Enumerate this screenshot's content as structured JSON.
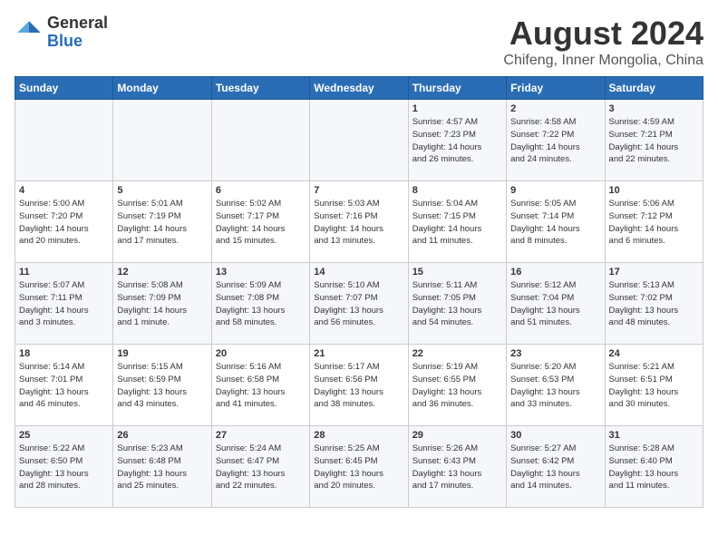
{
  "logo": {
    "general": "General",
    "blue": "Blue"
  },
  "title": "August 2024",
  "subtitle": "Chifeng, Inner Mongolia, China",
  "days_of_week": [
    "Sunday",
    "Monday",
    "Tuesday",
    "Wednesday",
    "Thursday",
    "Friday",
    "Saturday"
  ],
  "weeks": [
    [
      {
        "day": "",
        "info": ""
      },
      {
        "day": "",
        "info": ""
      },
      {
        "day": "",
        "info": ""
      },
      {
        "day": "",
        "info": ""
      },
      {
        "day": "1",
        "info": "Sunrise: 4:57 AM\nSunset: 7:23 PM\nDaylight: 14 hours\nand 26 minutes."
      },
      {
        "day": "2",
        "info": "Sunrise: 4:58 AM\nSunset: 7:22 PM\nDaylight: 14 hours\nand 24 minutes."
      },
      {
        "day": "3",
        "info": "Sunrise: 4:59 AM\nSunset: 7:21 PM\nDaylight: 14 hours\nand 22 minutes."
      }
    ],
    [
      {
        "day": "4",
        "info": "Sunrise: 5:00 AM\nSunset: 7:20 PM\nDaylight: 14 hours\nand 20 minutes."
      },
      {
        "day": "5",
        "info": "Sunrise: 5:01 AM\nSunset: 7:19 PM\nDaylight: 14 hours\nand 17 minutes."
      },
      {
        "day": "6",
        "info": "Sunrise: 5:02 AM\nSunset: 7:17 PM\nDaylight: 14 hours\nand 15 minutes."
      },
      {
        "day": "7",
        "info": "Sunrise: 5:03 AM\nSunset: 7:16 PM\nDaylight: 14 hours\nand 13 minutes."
      },
      {
        "day": "8",
        "info": "Sunrise: 5:04 AM\nSunset: 7:15 PM\nDaylight: 14 hours\nand 11 minutes."
      },
      {
        "day": "9",
        "info": "Sunrise: 5:05 AM\nSunset: 7:14 PM\nDaylight: 14 hours\nand 8 minutes."
      },
      {
        "day": "10",
        "info": "Sunrise: 5:06 AM\nSunset: 7:12 PM\nDaylight: 14 hours\nand 6 minutes."
      }
    ],
    [
      {
        "day": "11",
        "info": "Sunrise: 5:07 AM\nSunset: 7:11 PM\nDaylight: 14 hours\nand 3 minutes."
      },
      {
        "day": "12",
        "info": "Sunrise: 5:08 AM\nSunset: 7:09 PM\nDaylight: 14 hours\nand 1 minute."
      },
      {
        "day": "13",
        "info": "Sunrise: 5:09 AM\nSunset: 7:08 PM\nDaylight: 13 hours\nand 58 minutes."
      },
      {
        "day": "14",
        "info": "Sunrise: 5:10 AM\nSunset: 7:07 PM\nDaylight: 13 hours\nand 56 minutes."
      },
      {
        "day": "15",
        "info": "Sunrise: 5:11 AM\nSunset: 7:05 PM\nDaylight: 13 hours\nand 54 minutes."
      },
      {
        "day": "16",
        "info": "Sunrise: 5:12 AM\nSunset: 7:04 PM\nDaylight: 13 hours\nand 51 minutes."
      },
      {
        "day": "17",
        "info": "Sunrise: 5:13 AM\nSunset: 7:02 PM\nDaylight: 13 hours\nand 48 minutes."
      }
    ],
    [
      {
        "day": "18",
        "info": "Sunrise: 5:14 AM\nSunset: 7:01 PM\nDaylight: 13 hours\nand 46 minutes."
      },
      {
        "day": "19",
        "info": "Sunrise: 5:15 AM\nSunset: 6:59 PM\nDaylight: 13 hours\nand 43 minutes."
      },
      {
        "day": "20",
        "info": "Sunrise: 5:16 AM\nSunset: 6:58 PM\nDaylight: 13 hours\nand 41 minutes."
      },
      {
        "day": "21",
        "info": "Sunrise: 5:17 AM\nSunset: 6:56 PM\nDaylight: 13 hours\nand 38 minutes."
      },
      {
        "day": "22",
        "info": "Sunrise: 5:19 AM\nSunset: 6:55 PM\nDaylight: 13 hours\nand 36 minutes."
      },
      {
        "day": "23",
        "info": "Sunrise: 5:20 AM\nSunset: 6:53 PM\nDaylight: 13 hours\nand 33 minutes."
      },
      {
        "day": "24",
        "info": "Sunrise: 5:21 AM\nSunset: 6:51 PM\nDaylight: 13 hours\nand 30 minutes."
      }
    ],
    [
      {
        "day": "25",
        "info": "Sunrise: 5:22 AM\nSunset: 6:50 PM\nDaylight: 13 hours\nand 28 minutes."
      },
      {
        "day": "26",
        "info": "Sunrise: 5:23 AM\nSunset: 6:48 PM\nDaylight: 13 hours\nand 25 minutes."
      },
      {
        "day": "27",
        "info": "Sunrise: 5:24 AM\nSunset: 6:47 PM\nDaylight: 13 hours\nand 22 minutes."
      },
      {
        "day": "28",
        "info": "Sunrise: 5:25 AM\nSunset: 6:45 PM\nDaylight: 13 hours\nand 20 minutes."
      },
      {
        "day": "29",
        "info": "Sunrise: 5:26 AM\nSunset: 6:43 PM\nDaylight: 13 hours\nand 17 minutes."
      },
      {
        "day": "30",
        "info": "Sunrise: 5:27 AM\nSunset: 6:42 PM\nDaylight: 13 hours\nand 14 minutes."
      },
      {
        "day": "31",
        "info": "Sunrise: 5:28 AM\nSunset: 6:40 PM\nDaylight: 13 hours\nand 11 minutes."
      }
    ]
  ]
}
